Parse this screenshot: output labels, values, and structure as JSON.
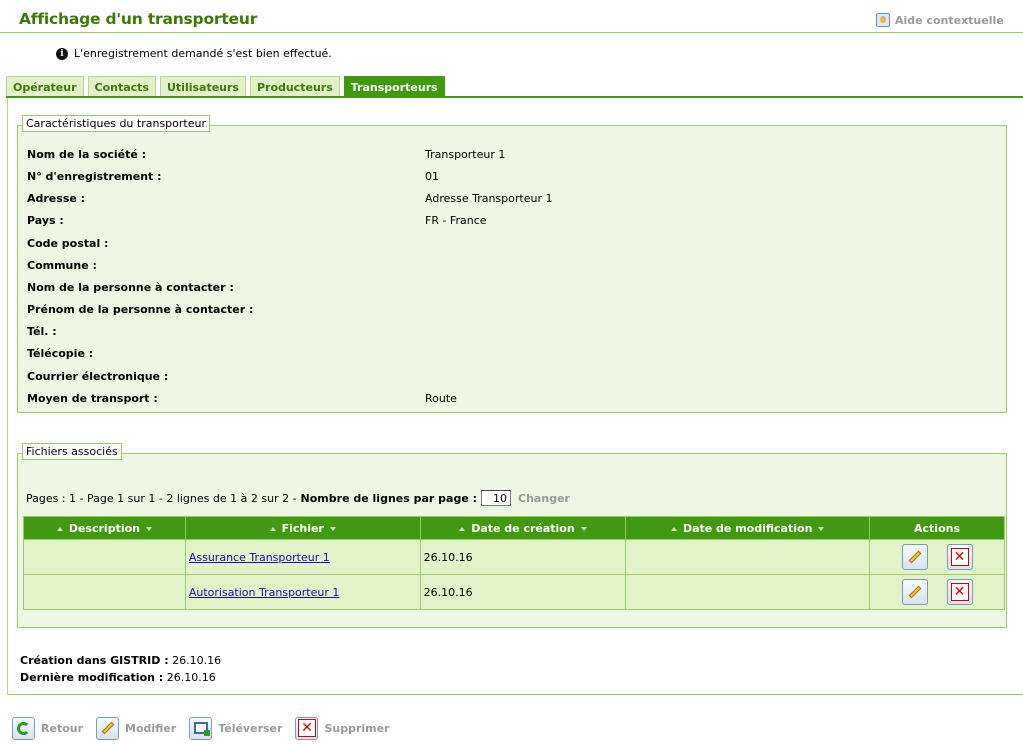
{
  "header": {
    "title": "Affichage d'un transporteur",
    "help_label": "Aide contextuelle"
  },
  "message": {
    "text": "L'enregistrement demandé s'est bien effectué."
  },
  "tabs": [
    {
      "label": "Opérateur",
      "active": false
    },
    {
      "label": "Contacts",
      "active": false
    },
    {
      "label": "Utilisateurs",
      "active": false
    },
    {
      "label": "Producteurs",
      "active": false
    },
    {
      "label": "Transporteurs",
      "active": true
    }
  ],
  "carrier": {
    "legend": "Caractéristiques du transporteur",
    "fields": [
      {
        "label": "Nom de la société :",
        "value": "Transporteur 1"
      },
      {
        "label": "N° d'enregistrement :",
        "value": "01"
      },
      {
        "label": "Adresse :",
        "value": "Adresse Transporteur 1"
      },
      {
        "label": "Pays :",
        "value": "FR - France"
      },
      {
        "label": "Code postal :",
        "value": ""
      },
      {
        "label": "Commune :",
        "value": ""
      },
      {
        "label": "Nom de la personne à contacter :",
        "value": ""
      },
      {
        "label": "Prénom de la personne à contacter :",
        "value": ""
      },
      {
        "label": "Tél. :",
        "value": ""
      },
      {
        "label": "Télécopie :",
        "value": ""
      },
      {
        "label": "Courrier électronique :",
        "value": ""
      },
      {
        "label": "Moyen de transport :",
        "value": "Route"
      }
    ]
  },
  "files": {
    "legend": "Fichiers associés",
    "pager_text": "Pages : 1 - Page 1 sur 1 - 2 lignes de 1 à 2 sur 2 -",
    "rows_per_page_label": "Nombre de lignes par page :",
    "rows_per_page_value": "10",
    "change_label": "Changer",
    "columns": [
      "Description",
      "Fichier",
      "Date de création",
      "Date de modification",
      "Actions"
    ],
    "rows": [
      {
        "description": "",
        "file": "Assurance Transporteur 1",
        "created": "26.10.16",
        "modified": ""
      },
      {
        "description": "",
        "file": "Autorisation Transporteur 1",
        "created": "26.10.16",
        "modified": ""
      }
    ]
  },
  "meta": {
    "created_label": "Création dans GISTRID :",
    "created_value": "26.10.16",
    "modified_label": "Dernière modification :",
    "modified_value": "26.10.16"
  },
  "toolbar": {
    "back_label": "Retour",
    "edit_label": "Modifier",
    "upload_label": "Téléverser",
    "delete_label": "Supprimer"
  },
  "colors": {
    "accent_green": "#3f9a12",
    "title_green": "#3d7a05",
    "panel_bg": "#eef7e3",
    "row_bg": "#e2f3c8"
  }
}
